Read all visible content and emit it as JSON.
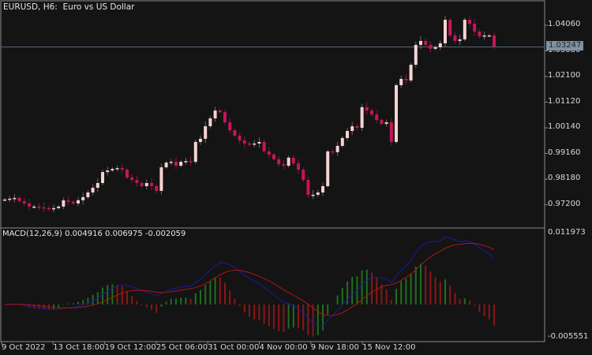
{
  "header": {
    "symbol": "EURUSD, H6:",
    "description": "Euro vs US Dollar"
  },
  "indicator": {
    "label": "MACD(12,26,9)",
    "values": [
      "0.004916",
      "0.006975",
      "-0.002059"
    ]
  },
  "current_price": "1.03247",
  "colors": {
    "background": "#141414",
    "bull": "#f6d3d3",
    "bear": "#c8145a",
    "macd_line": "#1a1aa8",
    "signal_line": "#b01414",
    "hist_up": "#1f6e1f",
    "hist_down": "#8c1616",
    "frame": "#8a8a8a"
  },
  "chart_data": [
    {
      "type": "candlestick",
      "title": "EURUSD, H6: Euro vs US Dollar",
      "ylim": [
        0.9685,
        1.0502
      ],
      "y_ticks": [
        "1.04060",
        "1.03080",
        "1.02100",
        "1.01120",
        "1.00140",
        "0.99160",
        "0.98180",
        "0.97200"
      ],
      "x_ticks": [
        "9 Oct 2022",
        "13 Oct 18:00",
        "19 Oct 12:00",
        "25 Oct 06:00",
        "31 Oct 00:00",
        "4 Nov 00:00",
        "9 Nov 18:00",
        "15 Nov 12:00"
      ],
      "first_open": 0.9738,
      "close": [
        0.974,
        0.9743,
        0.9746,
        0.9734,
        0.9725,
        0.9713,
        0.9713,
        0.971,
        0.9707,
        0.9704,
        0.9707,
        0.9713,
        0.9737,
        0.9731,
        0.9725,
        0.9737,
        0.9749,
        0.9767,
        0.9785,
        0.9803,
        0.9845,
        0.9851,
        0.9857,
        0.986,
        0.9854,
        0.9824,
        0.9815,
        0.9803,
        0.9791,
        0.9803,
        0.9791,
        0.9773,
        0.9863,
        0.9881,
        0.9884,
        0.9869,
        0.9884,
        0.9887,
        0.9884,
        0.996,
        0.9972,
        1.002,
        1.005,
        1.008,
        1.0074,
        1.0035,
        1.0005,
        0.9984,
        0.9966,
        0.9954,
        0.9951,
        0.9954,
        0.996,
        0.9924,
        0.9912,
        0.9894,
        0.9875,
        0.9869,
        0.99,
        0.9878,
        0.9854,
        0.9815,
        0.9758,
        0.9758,
        0.9767,
        0.9791,
        0.9924,
        0.9921,
        0.9945,
        0.9975,
        1.0002,
        1.002,
        1.0014,
        1.0093,
        1.008,
        1.0065,
        1.0044,
        1.0029,
        1.0035,
        0.996,
        1.0177,
        1.0201,
        1.0195,
        1.0255,
        1.0331,
        1.0346,
        1.0331,
        1.0316,
        1.0322,
        1.0337,
        1.0427,
        1.0367,
        1.0346,
        1.0352,
        1.0427,
        1.0412,
        1.0382,
        1.0364,
        1.0367,
        1.0367,
        1.03247
      ]
    },
    {
      "type": "line",
      "title": "MACD(12,26,9)",
      "ylim": [
        -0.005551,
        0.011973
      ],
      "y_ticks": [
        "0.011973",
        "-0.005551"
      ],
      "series": [
        {
          "name": "MACD",
          "params": [
            12,
            26,
            9
          ]
        },
        {
          "name": "Signal"
        },
        {
          "name": "Histogram"
        }
      ],
      "last_values": {
        "macd": 0.004916,
        "signal": 0.006975,
        "histogram": -0.002059
      }
    }
  ]
}
